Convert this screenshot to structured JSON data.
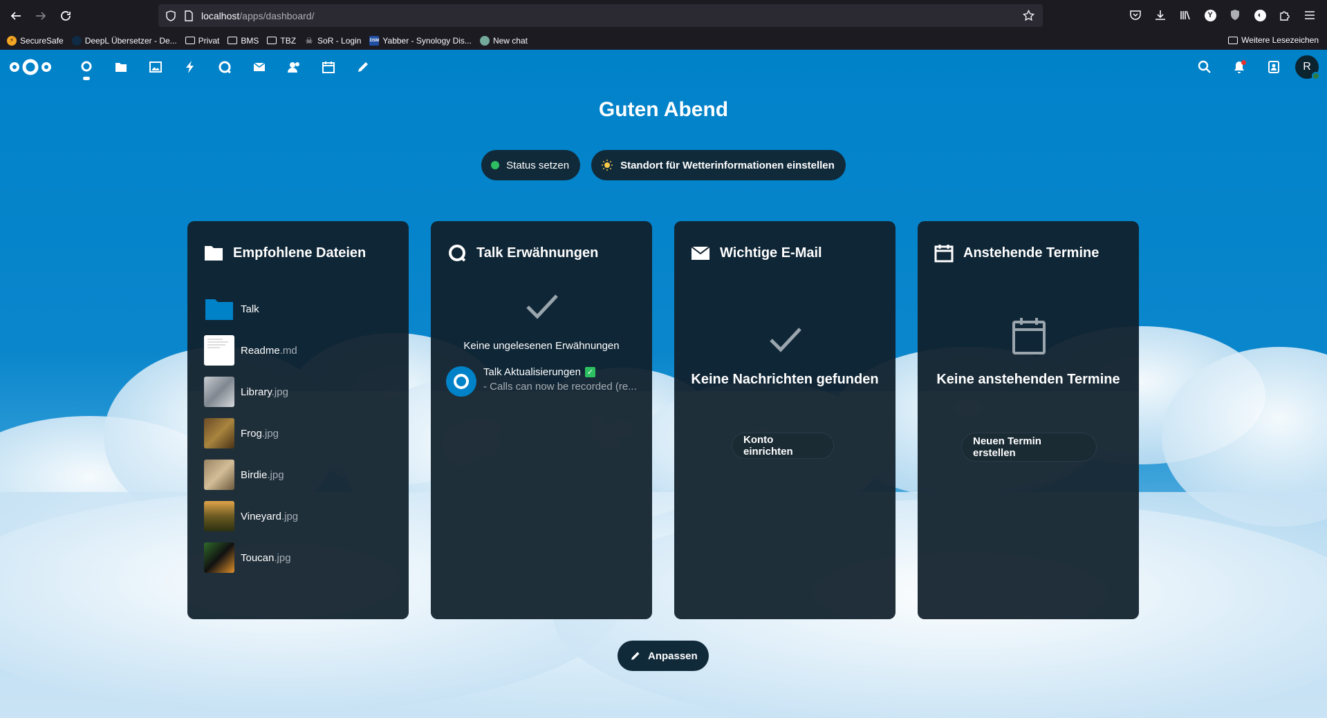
{
  "browser": {
    "url_host": "localhost",
    "url_path": "/apps/dashboard/",
    "bookmarks": [
      {
        "label": "SecureSafe",
        "icon": "securesafe-icon",
        "color": "#f5a623"
      },
      {
        "label": "DeepL Übersetzer - De...",
        "icon": "deepl-icon",
        "color": "#0f2b46"
      },
      {
        "label": "Privat",
        "icon": "folder-icon"
      },
      {
        "label": "BMS",
        "icon": "folder-icon"
      },
      {
        "label": "TBZ",
        "icon": "folder-icon"
      },
      {
        "label": "SoR - Login",
        "icon": "sor-icon",
        "color": "#cccccc"
      },
      {
        "label": "Yabber - Synology Dis...",
        "icon": "dsm-icon",
        "color": "#1f4fa3"
      },
      {
        "label": "New chat",
        "icon": "chatgpt-icon",
        "color": "#74aa9c"
      }
    ],
    "more_bookmarks": "Weitere Lesezeichen"
  },
  "nextcloud": {
    "greeting": "Guten Abend",
    "status_button": "Status setzen",
    "weather_button": "Standort für Wetterinformationen einstellen",
    "avatar_initial": "R",
    "customize_button": "Anpassen",
    "apps": [
      "dashboard-icon",
      "files-icon",
      "photos-icon",
      "activity-icon",
      "talk-icon",
      "mail-icon",
      "contacts-icon",
      "calendar-icon",
      "notes-icon"
    ]
  },
  "panels": {
    "files": {
      "title": "Empfohlene Dateien",
      "items": [
        {
          "name": "Talk",
          "ext": ""
        },
        {
          "name": "Readme",
          "ext": ".md"
        },
        {
          "name": "Library",
          "ext": ".jpg"
        },
        {
          "name": "Frog",
          "ext": ".jpg"
        },
        {
          "name": "Birdie",
          "ext": ".jpg"
        },
        {
          "name": "Vineyard",
          "ext": ".jpg"
        },
        {
          "name": "Toucan",
          "ext": ".jpg"
        }
      ]
    },
    "talk": {
      "title": "Talk Erwähnungen",
      "empty": "Keine ungelesenen Erwähnungen",
      "item_title": "Talk Aktualisierungen",
      "item_sub": "- Calls can now be recorded (re..."
    },
    "mail": {
      "title": "Wichtige E-Mail",
      "empty": "Keine Nachrichten gefunden",
      "button": "Konto einrichten"
    },
    "calendar": {
      "title": "Anstehende Termine",
      "empty": "Keine anstehenden Termine",
      "button": "Neuen Termin erstellen"
    }
  }
}
